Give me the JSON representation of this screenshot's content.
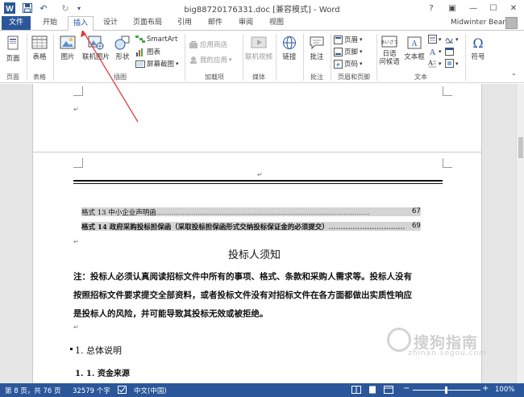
{
  "window": {
    "title": "big88720176331.doc [兼容模式] - Word",
    "controls": {
      "help": "?",
      "ribbon_display": "▣",
      "minimize": "—",
      "maximize": "☐",
      "close": "✕"
    }
  },
  "quick_access": {
    "save_icon": "💾",
    "undo_icon": "↶",
    "redo_icon": "↻",
    "customize_icon": "▾"
  },
  "tabs": [
    "文件",
    "开始",
    "插入",
    "设计",
    "页面布局",
    "引用",
    "邮件",
    "审阅",
    "视图"
  ],
  "active_tab": "插入",
  "user": "Midwinter Bear",
  "ribbon": {
    "pages": {
      "label": "页面",
      "group": "页面"
    },
    "table": {
      "label": "表格",
      "group": "表格"
    },
    "illustrations": {
      "group": "插图",
      "picture": "图片",
      "online_picture": "联机图片",
      "shapes": "形状",
      "smartart": "SmartArt",
      "chart": "图表",
      "screenshot": "屏幕截图"
    },
    "addins": {
      "group": "加载项",
      "store": "应用商店",
      "my_apps": "我的应用"
    },
    "media": {
      "group": "媒体",
      "online_video": "联机视频"
    },
    "links": {
      "label": "链接"
    },
    "comments": {
      "group": "批注",
      "comment": "批注"
    },
    "header_footer": {
      "group": "页眉和页脚",
      "header": "页眉",
      "footer": "页脚",
      "page_number": "页码"
    },
    "text": {
      "group": "文本",
      "quick_parts": "日语",
      "quick_parts2": "问候语",
      "textbox": "文本框"
    },
    "symbols": {
      "label": "符号"
    }
  },
  "document": {
    "paragraph_mark": "↵",
    "toc": [
      {
        "text": "格式 13 中小企业声明函",
        "page": "67"
      },
      {
        "text": "格式 14 政府采购投标担保函（采取投标担保函形式交纳投标保证金的必须提交）",
        "page": "69"
      }
    ],
    "heading": "投标人须知",
    "note_lines": [
      "注：投标人必须认真阅读招标文件中所有的事项、格式、条款和采购人需求等。投标人没有",
      "按照招标文件要求提交全部资料，或者投标文件没有对招标文件在各方面都做出实质性响应",
      "是投标人的风险，并可能导致其投标无效或被拒绝。"
    ],
    "section1": "1.   总体说明",
    "section1_1": "1. 1. 资金来源"
  },
  "watermark": {
    "line1": "搜狗指南",
    "line2": "zhinan.sogou.com"
  },
  "status": {
    "page": "第 8 页，共 76 页",
    "words": "32579 个字",
    "language": "中文(中国)",
    "zoom": "100%",
    "zoom_minus": "−",
    "zoom_plus": "+"
  },
  "colors": {
    "brand": "#2b579a",
    "annotation_arrow": "#e03c3c"
  }
}
